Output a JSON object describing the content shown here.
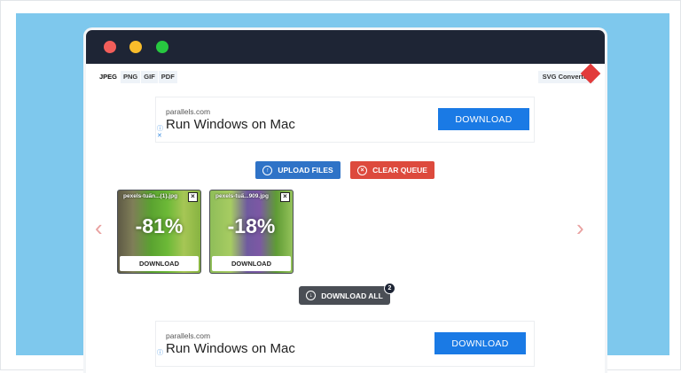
{
  "tabs": [
    "JPEG",
    "PNG",
    "GIF",
    "PDF"
  ],
  "svg_converter": "SVG Converter",
  "ad_top": {
    "domain": "parallels.com",
    "title": "Run Windows on Mac",
    "button": "DOWNLOAD",
    "info": "ⓘ",
    "close": "✕"
  },
  "ad_bottom": {
    "domain": "parallels.com",
    "title": "Run Windows on Mac",
    "button": "DOWNLOAD",
    "info": "ⓘ"
  },
  "buttons": {
    "upload": "UPLOAD FILES",
    "clear": "CLEAR QUEUE",
    "download_all": "DOWNLOAD ALL",
    "download_all_count": "2"
  },
  "nav": {
    "prev": "‹",
    "next": "›"
  },
  "files": [
    {
      "name": "pexels-tuấn...(1).jpg",
      "saving": "-81%",
      "download": "DOWNLOAD"
    },
    {
      "name": "pexels-tuấ...909.jpg",
      "saving": "-18%",
      "download": "DOWNLOAD"
    }
  ],
  "colors": {
    "background": "#7ec8ed",
    "titlebar": "#1e2535",
    "upload": "#2f73c7",
    "clear": "#dd4a3d",
    "ad_button": "#1a7ae5"
  }
}
